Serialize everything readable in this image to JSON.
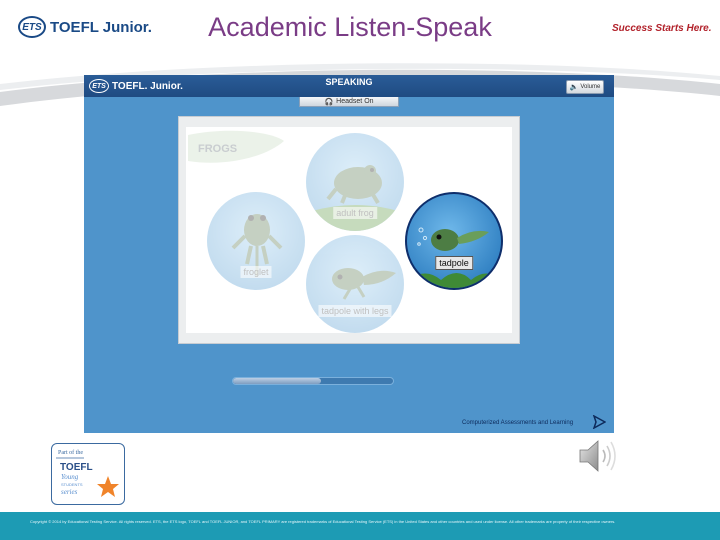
{
  "slide": {
    "title": "Academic Listen-Speak",
    "brand_text": "TOEFL Junior.",
    "brand_mark": "ETS",
    "tagline": "Success Starts Here."
  },
  "app": {
    "brand_mark": "ETS",
    "brand_text": "TOEFL. Junior.",
    "section_title": "SPEAKING",
    "volume_label": "Volume",
    "headset_label": "Headset On",
    "frogs_tag": "FROGS",
    "lifecycle": [
      {
        "id": "adult-frog",
        "label": "adult frog",
        "active": false
      },
      {
        "id": "froglet",
        "label": "froglet",
        "active": false
      },
      {
        "id": "tadpole",
        "label": "tadpole",
        "active": true
      },
      {
        "id": "tadpole-with-legs",
        "label": "tadpole with legs",
        "active": false
      }
    ],
    "progress": 0.55,
    "footer_brand": "Computerized Assessments and Learning"
  },
  "badge": {
    "line1": "Part of the",
    "line2": "TOEFL",
    "line3": "Young",
    "line4": "STUDENTS",
    "line5": "series"
  },
  "footer": {
    "copyright": "Copyright © 2014 by Educational Testing Service. All rights reserved. ETS, the ETS logo, TOEFL and TOEFL JUNIOR, and TOEFL PRIMARY are registered trademarks of Educational Testing Service (ETS) in the United States and other countries and used under license. All other trademarks are property of their respective owners."
  },
  "colors": {
    "title": "#7a3c86",
    "tagline": "#b2222b",
    "app_bg": "#4f94cb",
    "footer_bar": "#1d9bb4",
    "ets_blue": "#1a4a86"
  }
}
